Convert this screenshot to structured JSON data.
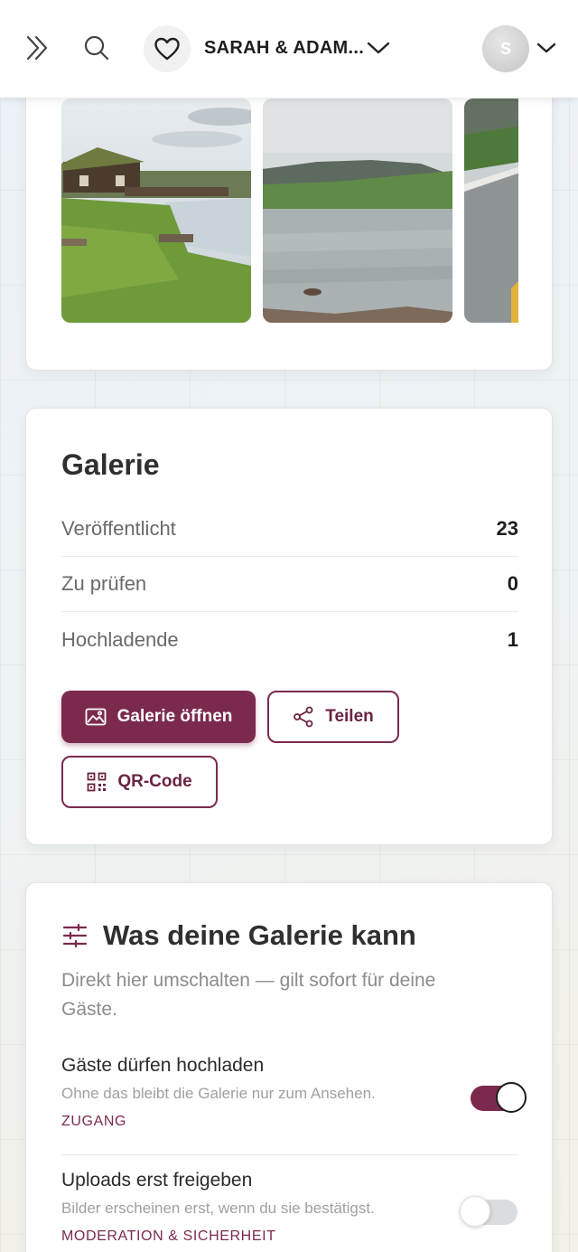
{
  "header": {
    "event_name": "SARAH & ADAM...",
    "avatar_initial": "S"
  },
  "gallery_card": {
    "title": "Galerie",
    "stats": [
      {
        "label": "Veröffentlicht",
        "value": "23"
      },
      {
        "label": "Zu prüfen",
        "value": "0"
      },
      {
        "label": "Hochladende",
        "value": "1"
      }
    ],
    "open_button": "Galerie öffnen",
    "share_button": "Teilen",
    "qr_button": "QR-Code"
  },
  "features_card": {
    "title": "Was deine Galerie kann",
    "subtitle": "Direkt hier umschalten — gilt sofort für deine Gäste.",
    "options": [
      {
        "title": "Gäste dürfen hochladen",
        "description": "Ohne das bleibt die Galerie nur zum Ansehen.",
        "tag": "ZUGANG",
        "enabled": true
      },
      {
        "title": "Uploads erst freigeben",
        "description": "Bilder erscheinen erst, wenn du sie bestätigst.",
        "tag": "MODERATION & SICHERHEIT",
        "enabled": false
      }
    ]
  },
  "colors": {
    "accent": "#7b2a4d",
    "toggle_off": "#d9dde0"
  },
  "icons": {
    "expand": "double-chevron-right-icon",
    "search": "search-icon",
    "event": "heart-icon",
    "gallery": "image-icon",
    "share": "share-icon",
    "qr": "qr-code-icon",
    "features": "sliders-icon"
  }
}
